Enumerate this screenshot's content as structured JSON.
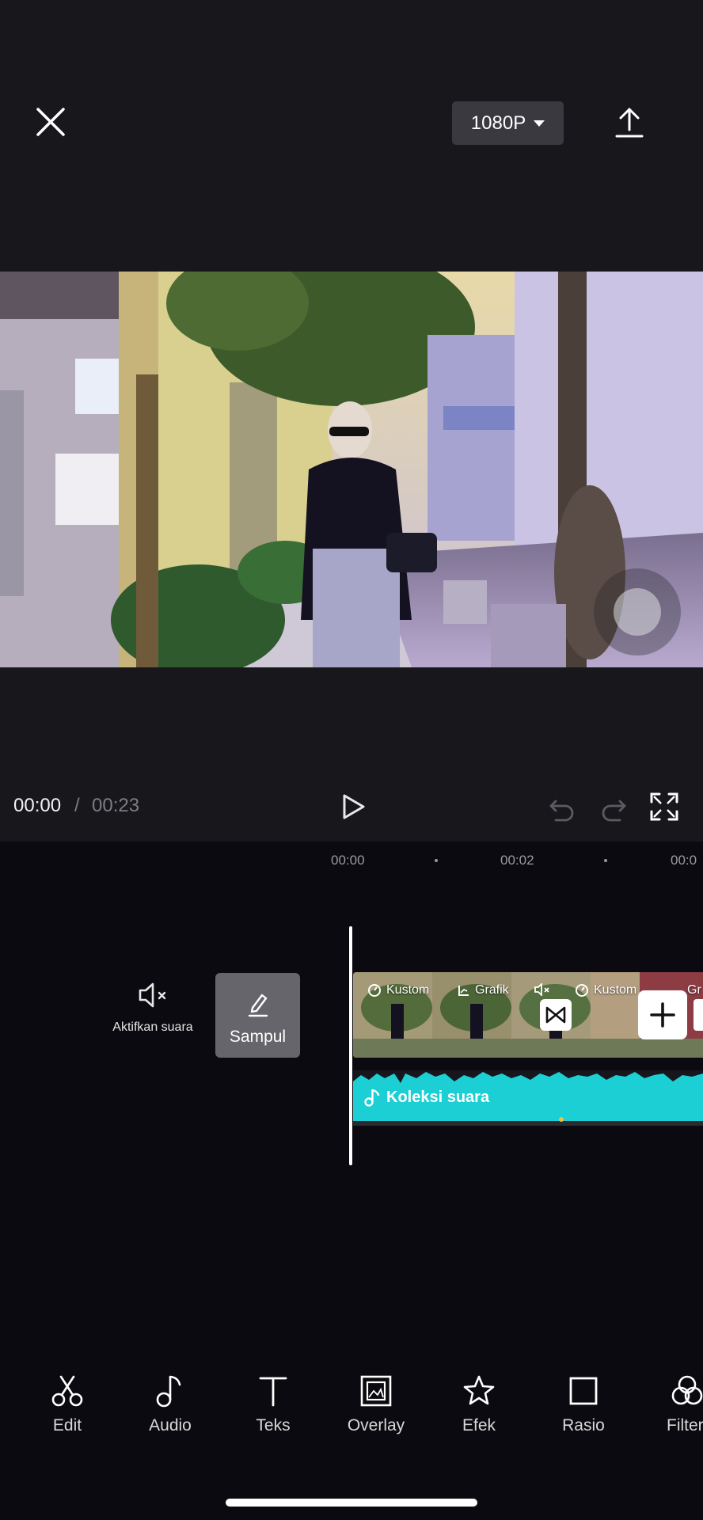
{
  "header": {
    "resolution": "1080P"
  },
  "playback": {
    "current_time": "00:00",
    "separator": "/",
    "total_time": "00:23"
  },
  "ruler": {
    "labels": [
      "00:00",
      "00:02",
      "00:0"
    ]
  },
  "track_controls": {
    "mute_label": "Aktifkan suara",
    "cover_label": "Sampul"
  },
  "clips": {
    "tags": [
      "Kustom",
      "Grafik",
      "Kustom",
      "Gr"
    ]
  },
  "audio": {
    "label": "Koleksi suara"
  },
  "toolbar": {
    "items": [
      {
        "label": "Edit",
        "icon": "scissors-icon"
      },
      {
        "label": "Audio",
        "icon": "music-note-icon"
      },
      {
        "label": "Teks",
        "icon": "text-icon"
      },
      {
        "label": "Overlay",
        "icon": "overlay-icon"
      },
      {
        "label": "Efek",
        "icon": "star-icon"
      },
      {
        "label": "Rasio",
        "icon": "square-icon"
      },
      {
        "label": "Filter",
        "icon": "filter-icon"
      }
    ]
  },
  "colors": {
    "background": "#0b0a10",
    "panel": "#18171c",
    "audio_track": "#1ccfd4",
    "cover_button": "#66656b"
  }
}
